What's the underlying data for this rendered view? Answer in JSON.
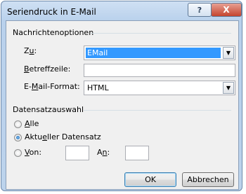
{
  "dialog": {
    "title": "Seriendruck in E-Mail",
    "help_glyph": "?",
    "close_glyph": "X"
  },
  "message_options": {
    "group_label": "Nachrichtenoptionen",
    "to": {
      "label_pre": "Z",
      "label_ul": "u",
      "label_post": ":",
      "value": "EMail"
    },
    "subject": {
      "label_pre": "",
      "label_ul": "B",
      "label_post": "etreffzeile:",
      "value": ""
    },
    "mail_format": {
      "label_pre": "E-",
      "label_ul": "M",
      "label_post": "ail-Format:",
      "value": "HTML"
    }
  },
  "record_selection": {
    "group_label": "Datensatzauswahl",
    "all": {
      "label_pre": "",
      "label_ul": "A",
      "label_post": "lle",
      "checked": false
    },
    "current": {
      "label_pre": "Aktu",
      "label_ul": "e",
      "label_post": "ller Datensatz",
      "checked": true
    },
    "from": {
      "label_pre": "",
      "label_ul": "V",
      "label_post": "on:",
      "checked": false,
      "value": ""
    },
    "to": {
      "label_pre": "A",
      "label_ul": "n",
      "label_post": ":",
      "value": ""
    }
  },
  "buttons": {
    "ok": "OK",
    "cancel": "Abbrechen"
  },
  "icons": {
    "dropdown": "triangle-down",
    "help": "question",
    "close": "x-mark"
  }
}
